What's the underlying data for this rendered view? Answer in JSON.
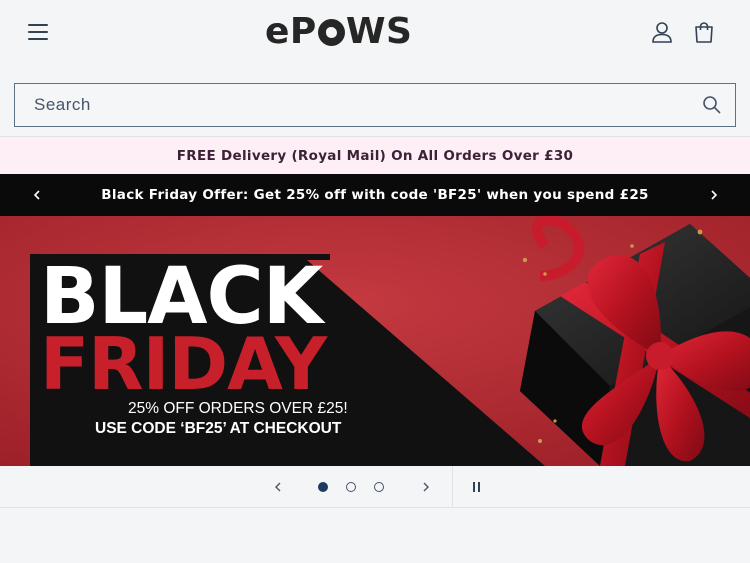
{
  "header": {
    "logo_text": "ePAWS",
    "logo_prefix": "e",
    "logo_suffix": "WS",
    "logo_mid": "P",
    "icons": [
      "menu-icon",
      "account-icon",
      "cart-icon"
    ]
  },
  "search": {
    "placeholder": "Search",
    "icon": "search-icon"
  },
  "announcement": {
    "text": "FREE Delivery (Royal Mail) On All Orders Over £30"
  },
  "offer_bar": {
    "text": "Black Friday Offer: Get 25% off with code 'BF25' when you spend £25",
    "icons": [
      "chevron-left-icon",
      "chevron-right-icon"
    ]
  },
  "hero": {
    "title_line1": "BLACK",
    "title_line2": "FRIDAY",
    "subtitle": "25% OFF ORDERS OVER £25!",
    "cta": "USE CODE ‘BF25’ AT CHECKOUT"
  },
  "slideshow": {
    "slide_count": 3,
    "active_slide": 1,
    "icons": [
      "chevron-left-icon",
      "chevron-right-icon",
      "pause-icon"
    ]
  },
  "colors": {
    "page_bg": "#f3f5f6",
    "announcement_bg": "#fdeff5",
    "offer_bar_bg": "#0a0a0a",
    "hero_red": "#b22a33",
    "friday_red": "#c8202a",
    "dot_active": "#1e3a5f"
  }
}
